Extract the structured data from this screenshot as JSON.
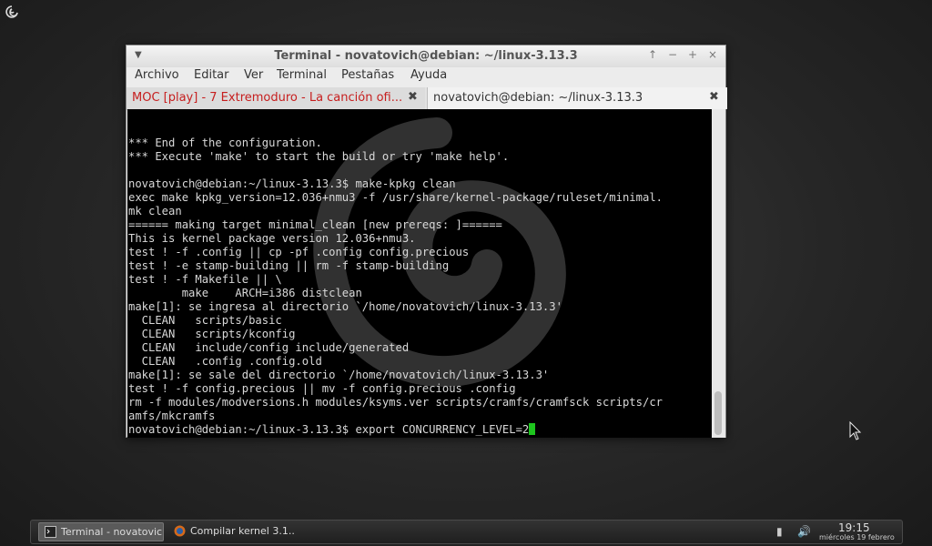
{
  "window": {
    "title": "Terminal - novatovich@debian: ~/linux-3.13.3",
    "controls": [
      "↑",
      "−",
      "+",
      "×"
    ]
  },
  "menubar": {
    "items": [
      "Archivo",
      "Editar",
      "Ver",
      "Terminal",
      "Pestañas",
      "Ayuda"
    ]
  },
  "tabs": [
    {
      "label": "MOC [play] - 7 Extremoduro - La canción ofi...",
      "color": "#c61e1e"
    },
    {
      "label": "novatovich@debian: ~/linux-3.13.3",
      "color": "#333333"
    }
  ],
  "terminal": {
    "lines": [
      "",
      "",
      "*** End of the configuration.",
      "*** Execute 'make' to start the build or try 'make help'.",
      "",
      "novatovich@debian:~/linux-3.13.3$ make-kpkg clean",
      "exec make kpkg_version=12.036+nmu3 -f /usr/share/kernel-package/ruleset/minimal.",
      "mk clean",
      "====== making target minimal_clean [new prereqs: ]======",
      "This is kernel package version 12.036+nmu3.",
      "test ! -f .config || cp -pf .config config.precious",
      "test ! -e stamp-building || rm -f stamp-building",
      "test ! -f Makefile || \\",
      "        make    ARCH=i386 distclean",
      "make[1]: se ingresa al directorio `/home/novatovich/linux-3.13.3'",
      "  CLEAN   scripts/basic",
      "  CLEAN   scripts/kconfig",
      "  CLEAN   include/config include/generated",
      "  CLEAN   .config .config.old",
      "make[1]: se sale del directorio `/home/novatovich/linux-3.13.3'",
      "test ! -f config.precious || mv -f config.precious .config",
      "rm -f modules/modversions.h modules/ksyms.ver scripts/cramfs/cramfsck scripts/cr",
      "amfs/mkcramfs"
    ],
    "prompt": "novatovich@debian:~/linux-3.13.3$ export CONCURRENCY_LEVEL=2",
    "cursor_color": "#1ec51e"
  },
  "taskbar": {
    "tasks": [
      {
        "label": "Terminal - novatovic...",
        "icon": "terminal-icon"
      },
      {
        "label": "Compilar kernel 3.1...",
        "icon": "browser-icon"
      }
    ],
    "clock_time": "19:15",
    "clock_date": "miércoles 19 febrero"
  }
}
